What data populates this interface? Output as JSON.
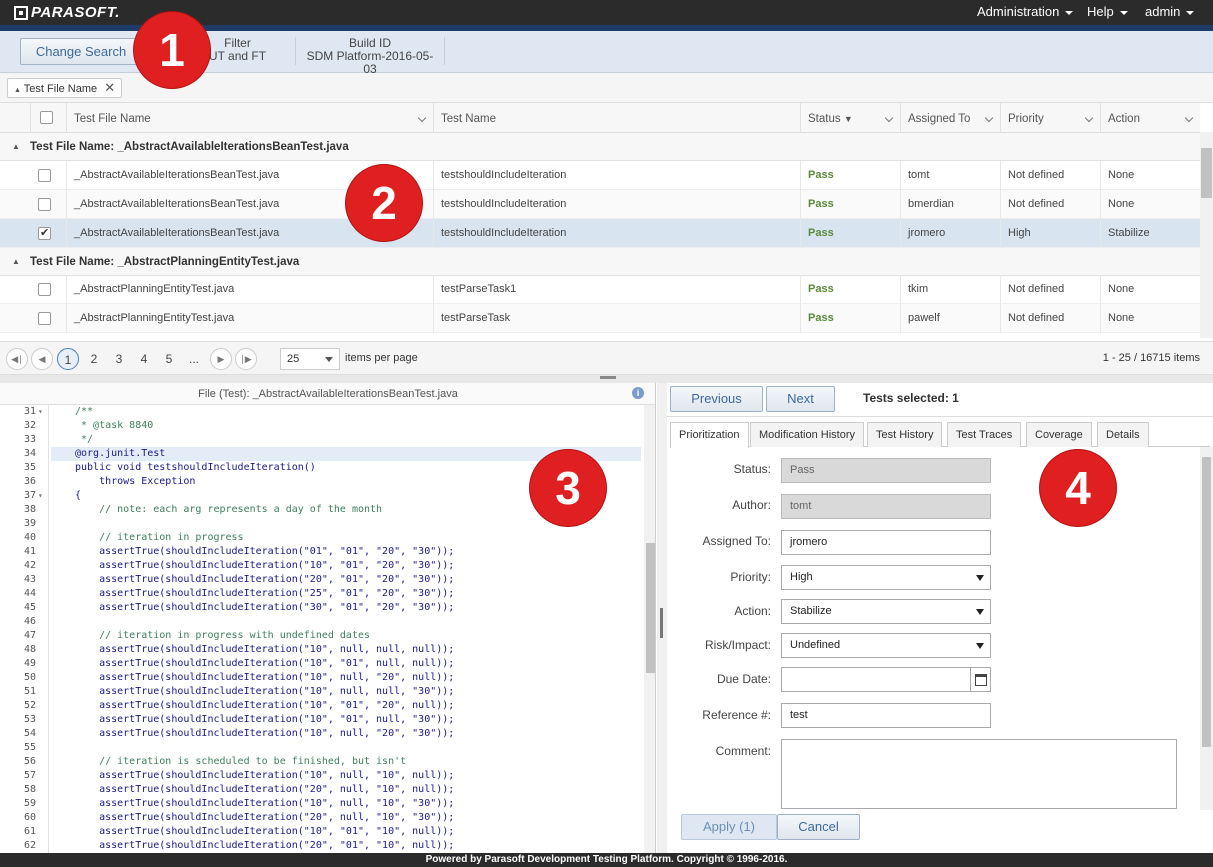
{
  "app": {
    "brand": "PARASOFT.",
    "menu": [
      "Administration",
      "Help",
      "admin"
    ]
  },
  "search": {
    "change_label": "Change Search",
    "filter_header": "Filter",
    "filter_value": "UT and FT",
    "build_header": "Build ID",
    "build_value": "SDM Platform-2016-05-03"
  },
  "grouping": {
    "chip_label": "Test File Name"
  },
  "grid": {
    "columns": [
      "Test File Name",
      "Test Name",
      "Status",
      "Assigned To",
      "Priority",
      "Action"
    ],
    "status_sort_glyph": "▼",
    "groups": [
      {
        "title": "Test File Name: _AbstractAvailableIterationsBeanTest.java",
        "rows": [
          {
            "file": "_AbstractAvailableIterationsBeanTest.java",
            "test": "testshouldIncludeIteration",
            "status": "Pass",
            "assigned": "tomt",
            "priority": "Not defined",
            "action": "None",
            "checked": false
          },
          {
            "file": "_AbstractAvailableIterationsBeanTest.java",
            "test": "testshouldIncludeIteration",
            "status": "Pass",
            "assigned": "bmerdian",
            "priority": "Not defined",
            "action": "None",
            "checked": false
          },
          {
            "file": "_AbstractAvailableIterationsBeanTest.java",
            "test": "testshouldIncludeIteration",
            "status": "Pass",
            "assigned": "jromero",
            "priority": "High",
            "action": "Stabilize",
            "checked": true
          }
        ]
      },
      {
        "title": "Test File Name: _AbstractPlanningEntityTest.java",
        "rows": [
          {
            "file": "_AbstractPlanningEntityTest.java",
            "test": "testParseTask1",
            "status": "Pass",
            "assigned": "tkim",
            "priority": "Not defined",
            "action": "None",
            "checked": false
          },
          {
            "file": "_AbstractPlanningEntityTest.java",
            "test": "testParseTask",
            "status": "Pass",
            "assigned": "pawelf",
            "priority": "Not defined",
            "action": "None",
            "checked": false
          }
        ]
      }
    ]
  },
  "pager": {
    "pages": [
      "1",
      "2",
      "3",
      "4",
      "5",
      "..."
    ],
    "current": "1",
    "per_page": "25",
    "per_page_label": "items per page",
    "summary": "1 - 25 / 16715 items"
  },
  "code": {
    "header": "File (Test): _AbstractAvailableIterationsBeanTest.java",
    "lines": [
      {
        "n": "31",
        "fold": true,
        "t": "/**",
        "c": "cm"
      },
      {
        "n": "32",
        "t": " * @task 8840",
        "c": "cm"
      },
      {
        "n": "33",
        "t": " */",
        "c": "cm"
      },
      {
        "n": "34",
        "t": "@org.junit.Test",
        "c": "",
        "hl": true
      },
      {
        "n": "35",
        "t": "public void testshouldIncludeIteration()",
        "c": ""
      },
      {
        "n": "36",
        "t": "    throws Exception",
        "c": ""
      },
      {
        "n": "37",
        "fold": true,
        "t": "{",
        "c": ""
      },
      {
        "n": "38",
        "t": "    // note: each arg represents a day of the month",
        "c": "cm"
      },
      {
        "n": "39",
        "t": "",
        "c": ""
      },
      {
        "n": "40",
        "t": "    // iteration in progress",
        "c": "cm"
      },
      {
        "n": "41",
        "t": "    assertTrue(shouldIncludeIteration(\"01\", \"01\", \"20\", \"30\"));",
        "c": ""
      },
      {
        "n": "42",
        "t": "    assertTrue(shouldIncludeIteration(\"10\", \"01\", \"20\", \"30\"));",
        "c": ""
      },
      {
        "n": "43",
        "t": "    assertTrue(shouldIncludeIteration(\"20\", \"01\", \"20\", \"30\"));",
        "c": ""
      },
      {
        "n": "44",
        "t": "    assertTrue(shouldIncludeIteration(\"25\", \"01\", \"20\", \"30\"));",
        "c": ""
      },
      {
        "n": "45",
        "t": "    assertTrue(shouldIncludeIteration(\"30\", \"01\", \"20\", \"30\"));",
        "c": ""
      },
      {
        "n": "46",
        "t": "",
        "c": ""
      },
      {
        "n": "47",
        "t": "    // iteration in progress with undefined dates",
        "c": "cm"
      },
      {
        "n": "48",
        "t": "    assertTrue(shouldIncludeIteration(\"10\", null, null, null));",
        "c": ""
      },
      {
        "n": "49",
        "t": "    assertTrue(shouldIncludeIteration(\"10\", \"01\", null, null));",
        "c": ""
      },
      {
        "n": "50",
        "t": "    assertTrue(shouldIncludeIteration(\"10\", null, \"20\", null));",
        "c": ""
      },
      {
        "n": "51",
        "t": "    assertTrue(shouldIncludeIteration(\"10\", null, null, \"30\"));",
        "c": ""
      },
      {
        "n": "52",
        "t": "    assertTrue(shouldIncludeIteration(\"10\", \"01\", \"20\", null));",
        "c": ""
      },
      {
        "n": "53",
        "t": "    assertTrue(shouldIncludeIteration(\"10\", \"01\", null, \"30\"));",
        "c": ""
      },
      {
        "n": "54",
        "t": "    assertTrue(shouldIncludeIteration(\"10\", null, \"20\", \"30\"));",
        "c": ""
      },
      {
        "n": "55",
        "t": "",
        "c": ""
      },
      {
        "n": "56",
        "t": "    // iteration is scheduled to be finished, but isn't",
        "c": "cm"
      },
      {
        "n": "57",
        "t": "    assertTrue(shouldIncludeIteration(\"10\", null, \"10\", null));",
        "c": ""
      },
      {
        "n": "58",
        "t": "    assertTrue(shouldIncludeIteration(\"20\", null, \"10\", null));",
        "c": ""
      },
      {
        "n": "59",
        "t": "    assertTrue(shouldIncludeIteration(\"10\", null, \"10\", \"30\"));",
        "c": ""
      },
      {
        "n": "60",
        "t": "    assertTrue(shouldIncludeIteration(\"20\", null, \"10\", \"30\"));",
        "c": ""
      },
      {
        "n": "61",
        "t": "    assertTrue(shouldIncludeIteration(\"10\", \"01\", \"10\", null));",
        "c": ""
      },
      {
        "n": "62",
        "t": "    assertTrue(shouldIncludeIteration(\"20\", \"01\", \"10\", null));",
        "c": ""
      }
    ]
  },
  "details": {
    "prev_label": "Previous",
    "next_label": "Next",
    "selected_text": "Tests selected: 1",
    "tabs": [
      "Prioritization",
      "Modification History",
      "Test History",
      "Test Traces",
      "Coverage",
      "Details"
    ],
    "form": {
      "status_label": "Status:",
      "status_value": "Pass",
      "author_label": "Author:",
      "author_value": "tomt",
      "assigned_label": "Assigned To:",
      "assigned_value": "jromero",
      "priority_label": "Priority:",
      "priority_value": "High",
      "action_label": "Action:",
      "action_value": "Stabilize",
      "risk_label": "Risk/Impact:",
      "risk_value": "Undefined",
      "due_label": "Due Date:",
      "due_value": "",
      "ref_label": "Reference #:",
      "ref_value": "test",
      "comment_label": "Comment:",
      "comment_value": ""
    },
    "apply_label": "Apply (1)",
    "cancel_label": "Cancel"
  },
  "footer": {
    "text": "Powered by Parasoft Development Testing Platform. Copyright © 1996-2016."
  },
  "badges": [
    "1",
    "2",
    "3",
    "4"
  ],
  "colors": {
    "topbar": "#2b2b2b",
    "accent": "#1e3a66",
    "pass": "#5a8a3a",
    "badge": "#e02020",
    "selected_row": "#d8e4f0"
  }
}
